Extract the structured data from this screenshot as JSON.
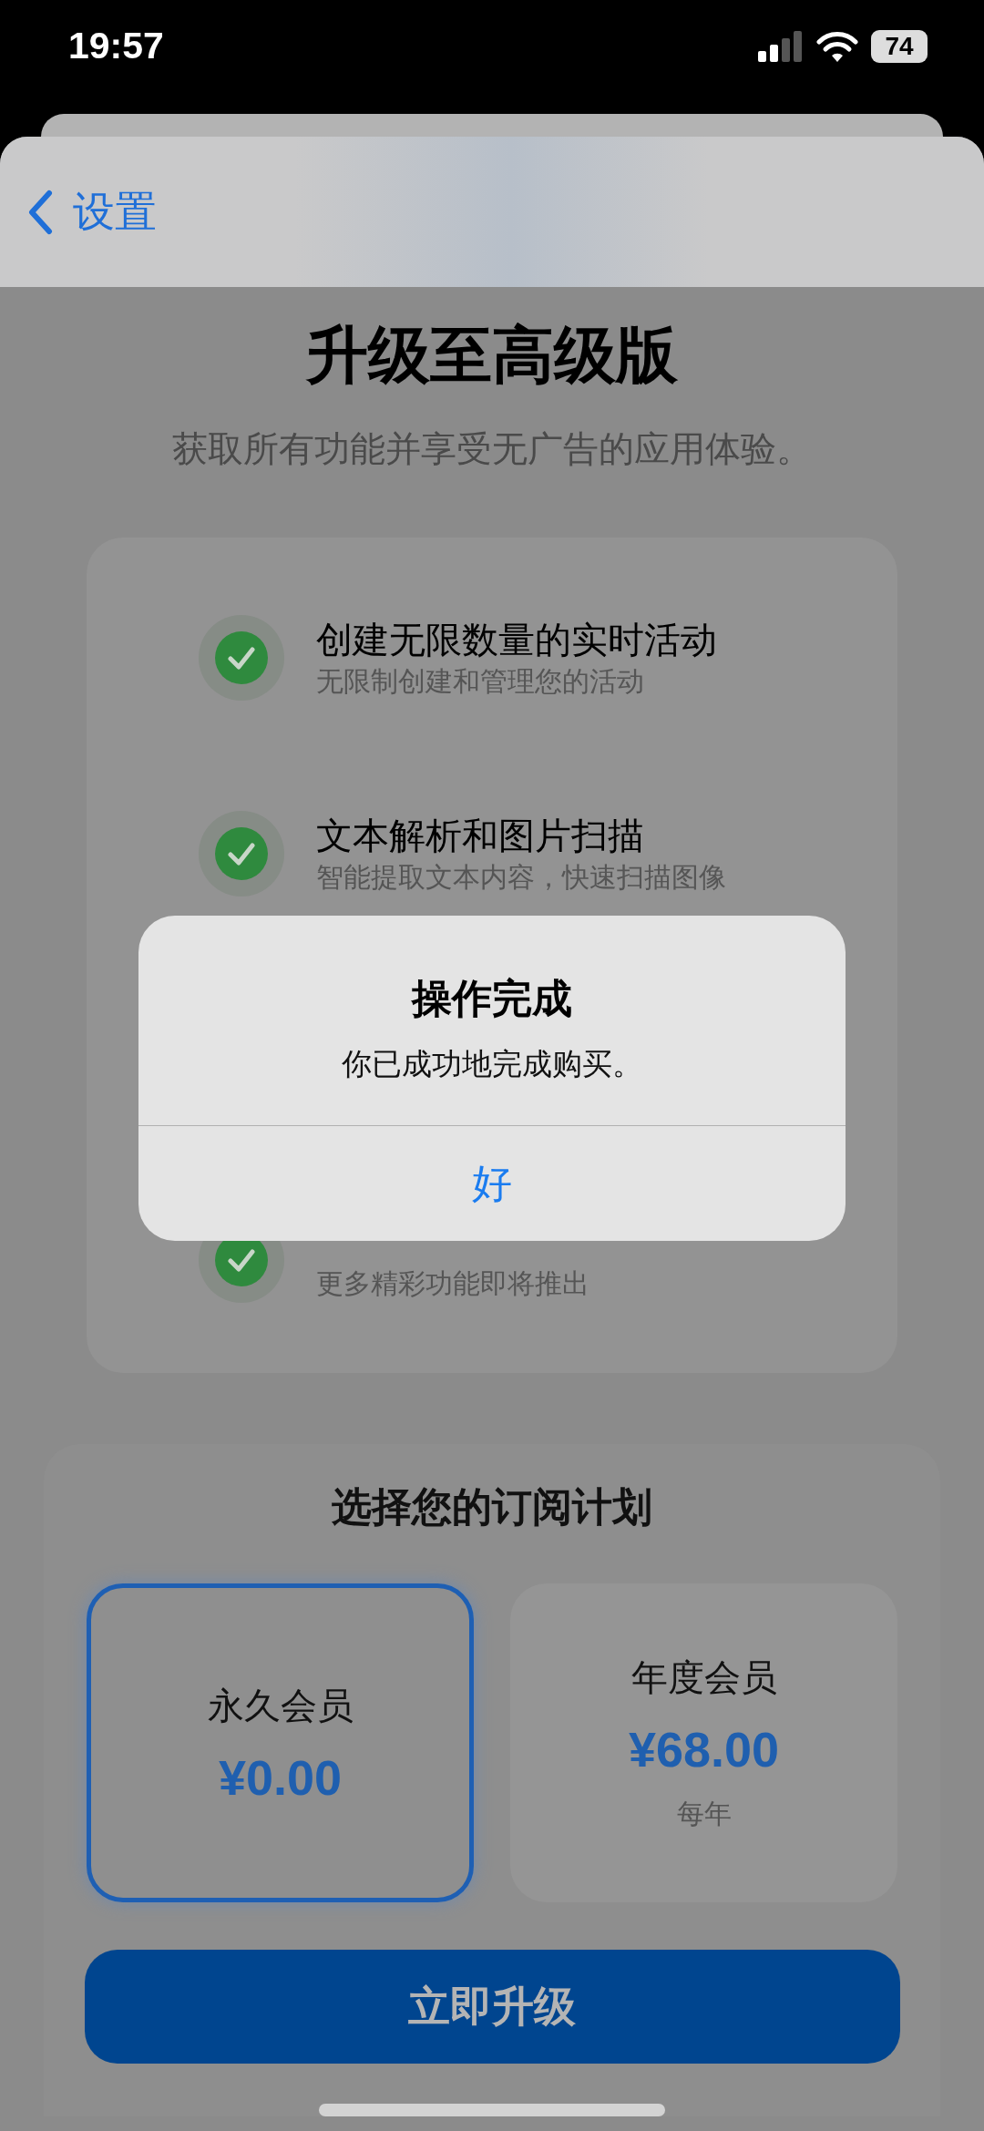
{
  "status_bar": {
    "time": "19:57",
    "battery": "74"
  },
  "nav": {
    "back": "设置"
  },
  "header": {
    "title": "升级至高级版",
    "subtitle": "获取所有功能并享受无广告的应用体验。"
  },
  "features": [
    {
      "title": "创建无限数量的实时活动",
      "description": "无限制创建和管理您的活动"
    },
    {
      "title": "文本解析和图片扫描",
      "description": "智能提取文本内容，快速扫描图像"
    },
    {
      "description": "更多精彩功能即将推出"
    }
  ],
  "plans": {
    "heading": "选择您的订阅计划",
    "options": [
      {
        "name": "永久会员",
        "price": "¥0.00",
        "selected": true
      },
      {
        "name": "年度会员",
        "price": "¥68.00",
        "period": "每年",
        "selected": false
      }
    ]
  },
  "upgrade_button": "立即升级",
  "alert": {
    "title": "操作完成",
    "message": "你已成功地完成购买。",
    "button": "好"
  }
}
